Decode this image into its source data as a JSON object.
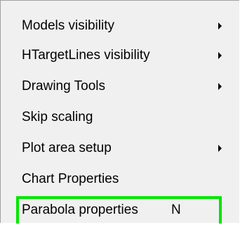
{
  "context_menu": {
    "items": [
      {
        "label": "Models visibility",
        "submenu": true
      },
      {
        "label": "HTargetLines visibility",
        "submenu": true
      },
      {
        "label": "Drawing Tools",
        "submenu": true
      },
      {
        "label": "Skip scaling",
        "submenu": false
      },
      {
        "label": "Plot area setup",
        "submenu": true
      },
      {
        "label": "Chart Properties",
        "submenu": false
      },
      {
        "label": "Parabola properties",
        "submenu": false,
        "shortcut": "N",
        "highlighted": true
      }
    ],
    "highlight_color": "#00e600",
    "submenu_icon": "chevron-right-icon"
  }
}
